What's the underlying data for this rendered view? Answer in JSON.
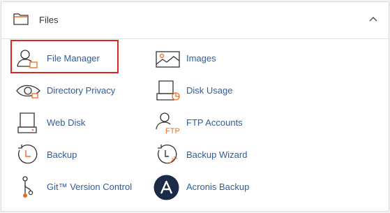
{
  "section": {
    "title": "Files"
  },
  "items": [
    {
      "label": "File Manager",
      "icon": "file-manager-icon"
    },
    {
      "label": "Images",
      "icon": "images-icon"
    },
    {
      "label": "Directory Privacy",
      "icon": "directory-privacy-icon"
    },
    {
      "label": "Disk Usage",
      "icon": "disk-usage-icon"
    },
    {
      "label": "Web Disk",
      "icon": "web-disk-icon"
    },
    {
      "label": "FTP Accounts",
      "icon": "ftp-accounts-icon"
    },
    {
      "label": "Backup",
      "icon": "backup-icon"
    },
    {
      "label": "Backup Wizard",
      "icon": "backup-wizard-icon"
    },
    {
      "label": "Git™ Version Control",
      "icon": "git-version-control-icon"
    },
    {
      "label": "Acronis Backup",
      "icon": "acronis-backup-icon"
    }
  ],
  "colors": {
    "link": "#2f5d9e",
    "accent": "#f26a21",
    "highlight": "#e02424",
    "acronis": "#1b2a47"
  }
}
